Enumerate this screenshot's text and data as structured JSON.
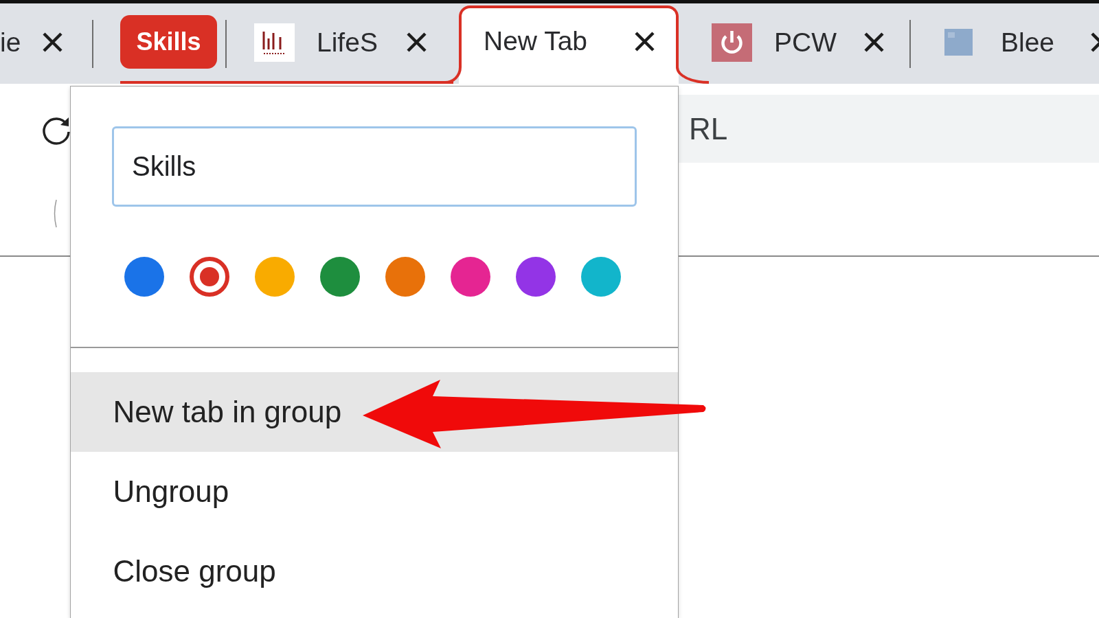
{
  "tab_strip": {
    "items": [
      {
        "kind": "tab",
        "title": "ie",
        "active": false,
        "grouped": false
      },
      {
        "kind": "group_chip",
        "label": "Skills"
      },
      {
        "kind": "tab",
        "title": "LifeS",
        "favicon": {
          "kind": "logo"
        },
        "active": false,
        "grouped": true
      },
      {
        "kind": "tab",
        "title": "New Tab",
        "active": true,
        "grouped": true
      },
      {
        "kind": "tab",
        "title": "PCW",
        "favicon": {
          "kind": "power"
        },
        "active": false,
        "grouped": false
      },
      {
        "kind": "tab",
        "title": "Blee",
        "favicon": {
          "kind": "tile"
        },
        "active": false,
        "grouped": false
      }
    ]
  },
  "toolbar": {
    "address_bar": {
      "placeholder": "RL"
    }
  },
  "group_menu": {
    "name_field": {
      "value": "Skills"
    },
    "color_swatches": [
      {
        "color": "#1a73e8",
        "selected": false
      },
      {
        "color": "#d93025",
        "selected": true
      },
      {
        "color": "#f9ab00",
        "selected": false
      },
      {
        "color": "#1e8e3e",
        "selected": false
      },
      {
        "color": "#e8710a",
        "selected": false
      },
      {
        "color": "#e52592",
        "selected": false
      },
      {
        "color": "#9334e6",
        "selected": false
      },
      {
        "color": "#12b5cb",
        "selected": false
      }
    ],
    "items": [
      {
        "label": "New tab in group",
        "highlighted": true
      },
      {
        "label": "Ungroup",
        "highlighted": false
      },
      {
        "label": "Close group",
        "highlighted": false
      }
    ]
  }
}
